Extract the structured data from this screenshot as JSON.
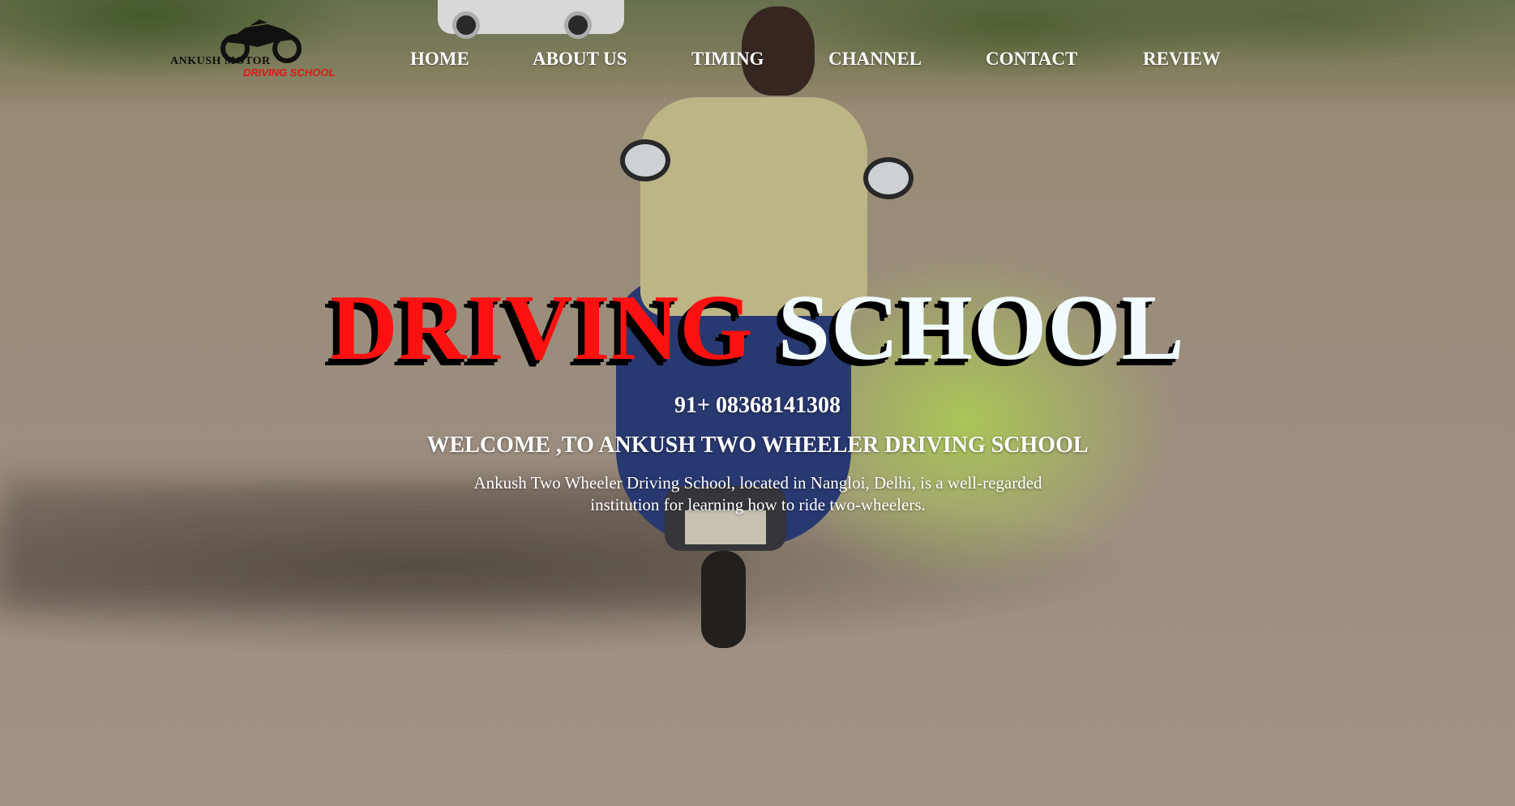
{
  "logo": {
    "line1": "ANKUSH MOTOR",
    "line2": "DRIVING SCHOOL",
    "icon": "motorcycle-icon"
  },
  "nav": {
    "items": [
      {
        "label": "HOME"
      },
      {
        "label": "ABOUT US"
      },
      {
        "label": "TIMING"
      },
      {
        "label": "CHANNEL"
      },
      {
        "label": "CONTACT"
      },
      {
        "label": "REVIEW"
      }
    ]
  },
  "hero": {
    "title_word1": "DRIVING",
    "title_word2": "SCHOOL",
    "phone": "91+ 08368141308",
    "welcome": "WELCOME ,TO ANKUSH TWO WHEELER DRIVING SCHOOL",
    "description": "Ankush Two Wheeler Driving School, located in Nangloi, Delhi, is a well-regarded institution for learning how to ride two-wheelers."
  },
  "colors": {
    "title_word1": "#ff1111",
    "title_word2": "#f2fbff",
    "nav_text": "#ffffff",
    "logo_accent": "#e01717"
  }
}
